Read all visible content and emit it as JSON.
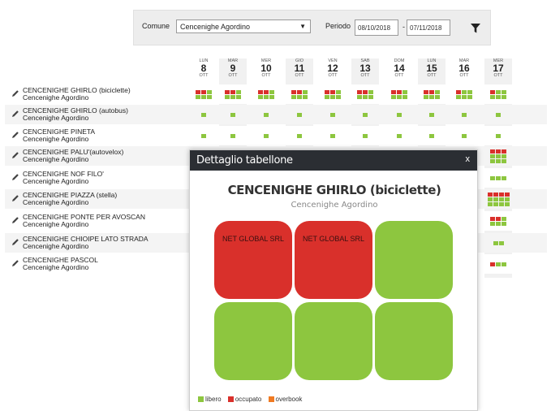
{
  "filter": {
    "comune_label": "Comune",
    "comune_value": "Cencenighe Agordino",
    "periodo_label": "Periodo",
    "date_from": "08/10/2018",
    "date_to": "07/11/2018",
    "date_sep": "-",
    "filter_icon": "funnel-icon"
  },
  "days": [
    {
      "dow": "LUN",
      "day": "8",
      "mon": "OTT"
    },
    {
      "dow": "MAR",
      "day": "9",
      "mon": "OTT"
    },
    {
      "dow": "MER",
      "day": "10",
      "mon": "OTT"
    },
    {
      "dow": "GIO",
      "day": "11",
      "mon": "OTT"
    },
    {
      "dow": "VEN",
      "day": "12",
      "mon": "OTT"
    },
    {
      "dow": "SAB",
      "day": "13",
      "mon": "OTT"
    },
    {
      "dow": "DOM",
      "day": "14",
      "mon": "OTT"
    },
    {
      "dow": "LUN",
      "day": "15",
      "mon": "OTT"
    },
    {
      "dow": "MAR",
      "day": "16",
      "mon": "OTT"
    },
    {
      "dow": "MER",
      "day": "17",
      "mon": "OTT"
    }
  ],
  "rows": [
    {
      "name": "CENCENIGHE GHIRLO (biciclette)",
      "place": "Cencenighe Agordino"
    },
    {
      "name": "CENCENIGHE GHIRLO (autobus)",
      "place": "Cencenighe Agordino"
    },
    {
      "name": "CENCENIGHE PINETA",
      "place": "Cencenighe Agordino"
    },
    {
      "name": "CENCENIGHE PALU'(autovelox)",
      "place": "Cencenighe Agordino"
    },
    {
      "name": "CENCENIGHE NOF FILO'",
      "place": "Cencenighe Agordino"
    },
    {
      "name": "CENCENIGHE PIAZZA (stella)",
      "place": "Cencenighe Agordino"
    },
    {
      "name": "CENCENIGHE PONTE PER AVOSCAN",
      "place": "Cencenighe Agordino"
    },
    {
      "name": "CENCENIGHE CHIOIPE LATO STRADA",
      "place": "Cencenighe Agordino"
    },
    {
      "name": "CENCENIGHE PASCOL",
      "place": "Cencenighe Agordino"
    }
  ],
  "modal": {
    "header": "Dettaglio tabellone",
    "close": "x",
    "title": "CENCENIGHE GHIRLO (biciclette)",
    "subtitle": "Cencenighe Agordino",
    "boards": [
      {
        "label": "NET GLOBAL SRL",
        "status": "occupato"
      },
      {
        "label": "NET GLOBAL SRL",
        "status": "occupato"
      },
      {
        "label": "",
        "status": "libero"
      },
      {
        "label": "",
        "status": "libero"
      },
      {
        "label": "",
        "status": "libero"
      },
      {
        "label": "",
        "status": "libero"
      }
    ],
    "legend": [
      {
        "label": "libero",
        "color": "#8dc63f"
      },
      {
        "label": "occupato",
        "color": "#d9302b"
      },
      {
        "label": "overbook",
        "color": "#f07a22"
      }
    ]
  },
  "colors": {
    "libero": "#8dc63f",
    "occupato": "#d9302b",
    "overbook": "#f07a22",
    "header": "#2b2e33"
  }
}
